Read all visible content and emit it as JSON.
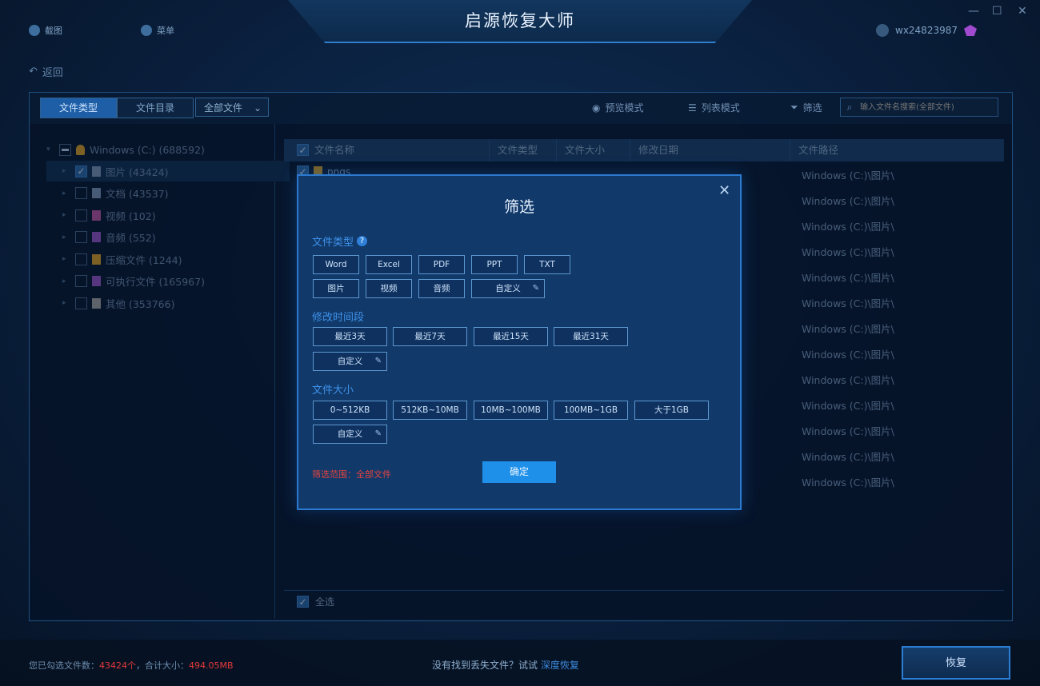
{
  "app": {
    "title": "启源恢复大师",
    "nav": [
      {
        "label": "截图"
      },
      {
        "label": "菜单"
      }
    ],
    "user": "wx24823987",
    "win_controls": [
      "—",
      "☐",
      "✕"
    ],
    "back_label": "返回"
  },
  "toolbar": {
    "tabs": [
      {
        "label": "文件类型",
        "active": true
      },
      {
        "label": "文件目录",
        "active": false
      }
    ],
    "filter_select": "全部文件",
    "preview_mode": "预览模式",
    "list_mode": "列表模式",
    "filter": "筛选",
    "search_placeholder": "输入文件名搜索(全部文件)"
  },
  "tree": {
    "root": "Windows (C:) (688592)",
    "items": [
      {
        "label": "图片 (43424)",
        "checked": true,
        "color": "#7f9cc0"
      },
      {
        "label": "文档 (43537)",
        "checked": false,
        "color": "#7f9cc0"
      },
      {
        "label": "视频 (102)",
        "checked": false,
        "color": "#c05aa8"
      },
      {
        "label": "音频 (552)",
        "checked": false,
        "color": "#9b58d0"
      },
      {
        "label": "压缩文件 (1244)",
        "checked": false,
        "color": "#e0a628"
      },
      {
        "label": "可执行文件 (165967)",
        "checked": false,
        "color": "#9b58d0"
      },
      {
        "label": "其他 (353766)",
        "checked": false,
        "color": "#a8a8a8"
      }
    ]
  },
  "table": {
    "columns": [
      "文件名称",
      "文件类型",
      "文件大小",
      "修改日期",
      "文件路径"
    ],
    "partial_name": "pngs",
    "path_value": "Windows (C:)\\图片\\",
    "row_count": 13,
    "select_all_label": "全选"
  },
  "status": {
    "prefix": "您已勾选文件数：",
    "count": "43424个",
    "total_label": "，合计大小：",
    "size": "494.05MB",
    "hint": "没有找到丢失文件？试试",
    "deep_scan": "深度恢复",
    "recover_label": "恢复"
  },
  "modal": {
    "title": "筛选",
    "close": "✕",
    "file_type_label": "文件类型",
    "help": "?",
    "file_types": [
      "Word",
      "Excel",
      "PDF",
      "PPT",
      "TXT",
      "图片",
      "视频",
      "音频"
    ],
    "custom": "自定义",
    "time_label": "修改时间段",
    "times": [
      "最近3天",
      "最近7天",
      "最近15天",
      "最近31天"
    ],
    "size_label": "文件大小",
    "sizes": [
      "0~512KB",
      "512KB~10MB",
      "10MB~100MB",
      "100MB~1GB",
      "大于1GB"
    ],
    "range_prefix": "筛选范围：",
    "range_value": "全部文件",
    "ok": "确定"
  },
  "colors": {
    "accent": "#1f90ea",
    "warn": "#e53a3a",
    "border": "#2b7ad0"
  }
}
